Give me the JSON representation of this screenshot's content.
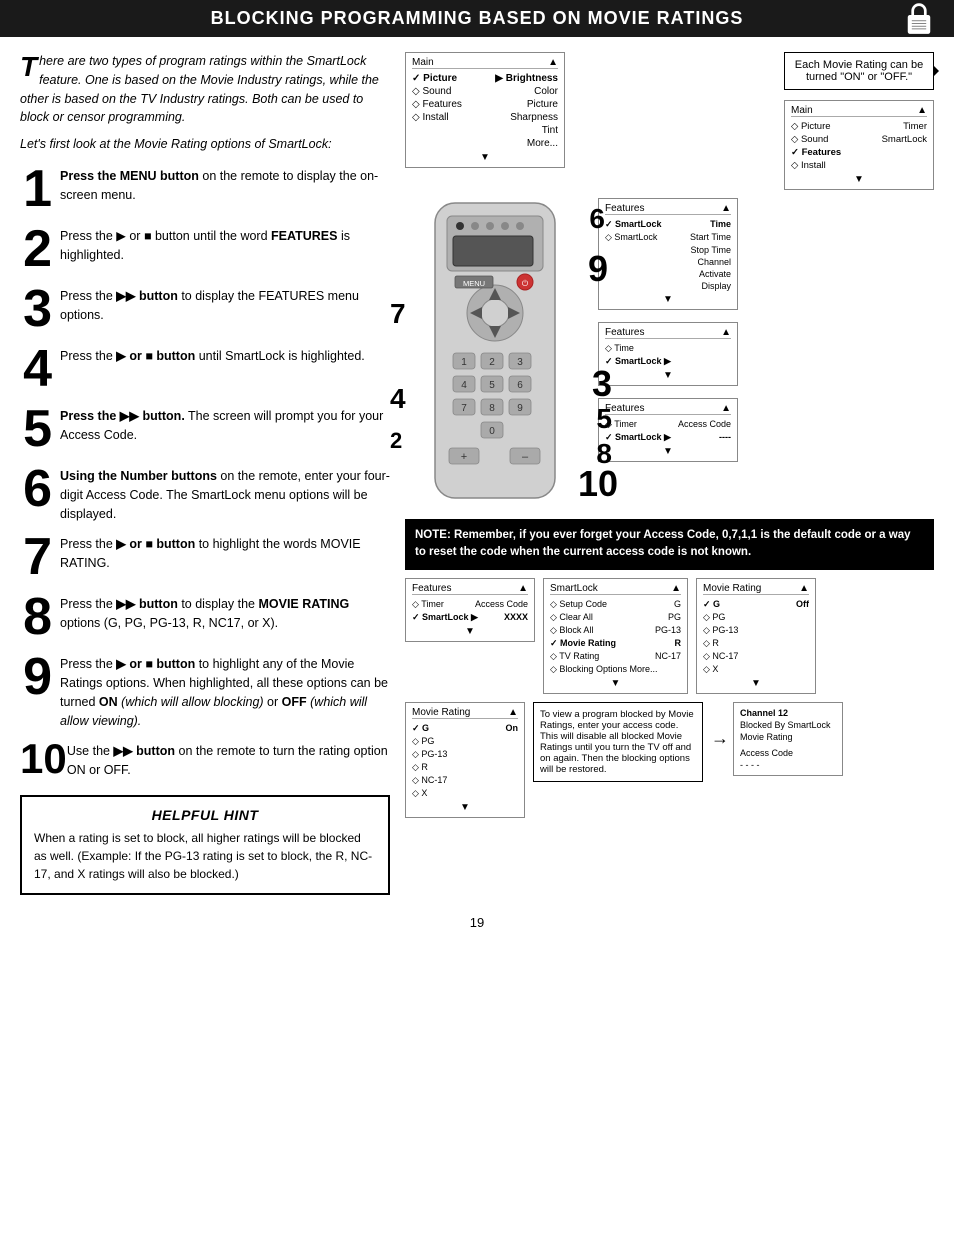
{
  "header": {
    "title": "Blocking Programming Based on Movie Ratings"
  },
  "intro": {
    "paragraph": "here are two types of program ratings within the SmartLock feature. One is based on the Movie Industry ratings, while the other is based on the TV Industry ratings. Both can be used to block or censor programming.",
    "first_letter": "T",
    "subtitle": "Let's first look at the Movie Rating options of SmartLock:"
  },
  "steps": [
    {
      "number": "1",
      "text": "Press the MENU button on the remote to display the on-screen menu."
    },
    {
      "number": "2",
      "text": "Press the ▶ or ■ button until the word FEATURES is highlighted."
    },
    {
      "number": "3",
      "text": "Press the ▶▶ button to display the FEATURES menu options."
    },
    {
      "number": "4",
      "text": "Press the ▶ or ■ button until SmartLock is highlighted."
    },
    {
      "number": "5",
      "text": "Press the ▶▶ button. The screen will prompt you for your Access Code."
    },
    {
      "number": "6",
      "text": "Using the Number buttons on the remote, enter your four-digit Access Code. The SmartLock menu options will be displayed."
    },
    {
      "number": "7",
      "text": "Press the ▶ or ■ button to highlight the words MOVIE RATING."
    },
    {
      "number": "8",
      "text": "Press the ▶▶ button to display the MOVIE RATING options (G, PG, PG-13, R, NC17, or X)."
    },
    {
      "number": "9",
      "text": "Press the ▶ or ■ button to highlight any of the Movie Ratings options. When highlighted, all these options can be turned ON (which will allow blocking) or OFF (which will allow viewing)."
    },
    {
      "number": "10",
      "text": "Use the ▶▶ button on the remote to turn the rating option ON or OFF."
    }
  ],
  "hint": {
    "title": "Helpful Hint",
    "text": "When a rating is set to block, all higher ratings will be blocked as well. (Example: If the PG-13 rating is set to block, the R, NC-17, and X ratings will also be blocked.)"
  },
  "callout": {
    "text": "Each Movie Rating can be turned \"ON\" or \"OFF.\""
  },
  "note": {
    "text": "NOTE: Remember, if you ever forget your Access Code, 0,7,1,1 is the default code or a way to reset the code when the current access code is not known."
  },
  "screens": {
    "screen1_title": "Main",
    "screen1_rows": [
      "✓ Picture   ▶  Brightness",
      "◇ Sound        Color",
      "◇ Features     Picture",
      "◇ Install       Sharpness",
      "                Tint",
      "                More..."
    ],
    "screen2_title": "Main",
    "screen2_rows": [
      "◇ Picture       Timer",
      "◇ Sound         SmartLock",
      "✓ Features",
      "◇ Install"
    ],
    "screen3_title": "Features",
    "screen3_rows": [
      "✓ SmartLock    Time",
      "◇ SmartLock    Start Time",
      "               Stop Time",
      "               Channel",
      "               Activate",
      "               Display"
    ],
    "screen4_title": "Features",
    "screen4_rows": [
      "◇ Timer",
      "✓ SmartLock  ▶"
    ],
    "screen5_title": "Features",
    "screen5_rows": [
      "◇ Timer         Access Code",
      "◇ SmartLock  ▶  XXXX"
    ],
    "screen6_title": "SmartLock",
    "screen6_rows": [
      "◇ Setup Code    G",
      "◇ Clear All     PG",
      "◇ Block All     PG-13",
      "✓ Movie Rating  R",
      "◇ TV Rating     NC-17",
      "◇ Blocking Options More..."
    ],
    "screen7_title": "Movie Rating",
    "screen7_rows": [
      "✓ G             Off",
      "◇ PG",
      "◇ PG-13",
      "◇ R",
      "◇ NC-17",
      "◇ X"
    ],
    "screen8_title": "Features",
    "screen8_rows": [
      "◇ Timer         Access Code",
      "✓ SmartLock  ▶  ----"
    ],
    "screen9_title": "Movie Rating",
    "screen9_rows": [
      "✓ G             On",
      "◇ PG",
      "◇ PG-13",
      "◇ R",
      "◇ NC-17",
      "◇ X"
    ],
    "screen10_title": "Channel 12",
    "screen10_rows": [
      "Blocked By SmartLock",
      "Movie Rating",
      "",
      "Access Code",
      "- - - -"
    ],
    "screen_blocked_title": "To view blocked",
    "screen_blocked_text": "To view a program blocked by Movie Ratings, enter your access code. This will disable all blocked Movie Ratings until you turn the TV off and on again. Then the blocking options will be restored."
  },
  "page_number": "19"
}
